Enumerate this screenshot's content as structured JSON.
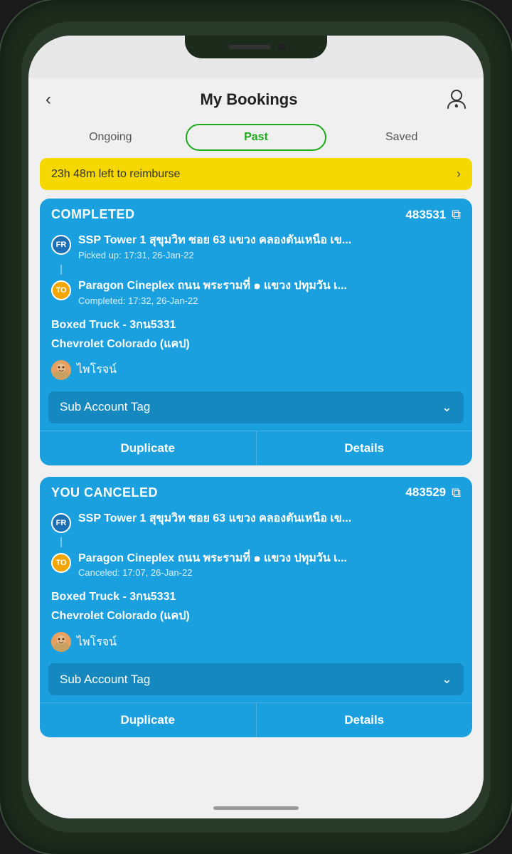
{
  "header": {
    "title": "My Bookings",
    "back_label": "‹",
    "support_icon": "👤"
  },
  "tabs": [
    {
      "label": "Ongoing",
      "active": false
    },
    {
      "label": "Past",
      "active": true
    },
    {
      "label": "Saved",
      "active": false
    }
  ],
  "reimburse_banner": {
    "text": "23h 48m left to reimburse",
    "arrow": "›"
  },
  "bookings": [
    {
      "status": "COMPLETED",
      "id": "483531",
      "from_badge": "FR",
      "from_location": "SSP Tower 1 สุขุมวิท ซอย 63 แขวง คลองตันเหนือ เข...",
      "from_sub": "Picked up: 17:31, 26-Jan-22",
      "to_badge": "TO",
      "to_location": "Paragon Cineplex ถนน พระรามที่ ๑ แขวง ปทุมวัน เ...",
      "to_sub": "Completed: 17:32, 26-Jan-22",
      "vehicle": "Boxed Truck - 3กน5331",
      "car_model": "Chevrolet Colorado (แคป)",
      "driver_name": "ไพโรจน์",
      "sub_account_tag": "Sub Account Tag",
      "duplicate_btn": "Duplicate",
      "details_btn": "Details"
    },
    {
      "status": "YOU CANCELED",
      "id": "483529",
      "from_badge": "FR",
      "from_location": "SSP Tower 1 สุขุมวิท ซอย 63 แขวง คลองตันเหนือ เข...",
      "from_sub": "",
      "to_badge": "TO",
      "to_location": "Paragon Cineplex ถนน พระรามที่ ๑ แขวง ปทุมวัน เ...",
      "to_sub": "Canceled: 17:07, 26-Jan-22",
      "vehicle": "Boxed Truck - 3กน5331",
      "car_model": "Chevrolet Colorado (แคป)",
      "driver_name": "ไพโรจน์",
      "sub_account_tag": "Sub Account Tag",
      "duplicate_btn": "Duplicate",
      "details_btn": "Details"
    }
  ]
}
